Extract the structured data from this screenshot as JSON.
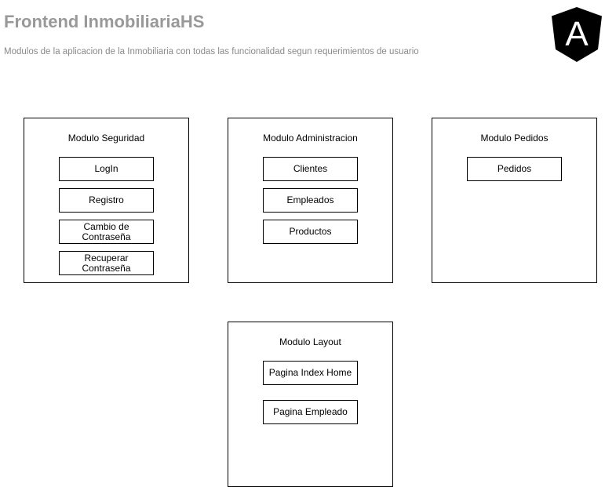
{
  "header": {
    "title": "Frontend InmobiliariaHS",
    "subtitle": "Modulos de la aplicacion de la Inmobiliaria con todas las funcionalidad segun requerimientos de usuario",
    "logo_letter": "A",
    "logo_icon": "angular-logo-icon"
  },
  "colors": {
    "title": "#999999",
    "subtitle": "#8a8a8a",
    "logo": "#000000",
    "border": "#000000"
  },
  "modules": {
    "seguridad": {
      "title": "Modulo Seguridad",
      "items": [
        "LogIn",
        "Registro",
        "Cambio de Contraseña",
        "Recuperar Contraseña"
      ]
    },
    "administracion": {
      "title": "Modulo Administracion",
      "items": [
        "Clientes",
        "Empleados",
        "Productos"
      ]
    },
    "pedidos": {
      "title": "Modulo Pedidos",
      "items": [
        "Pedidos"
      ]
    },
    "layout": {
      "title": "Modulo Layout",
      "items": [
        "Pagina Index Home",
        "Pagina Empleado"
      ]
    }
  }
}
